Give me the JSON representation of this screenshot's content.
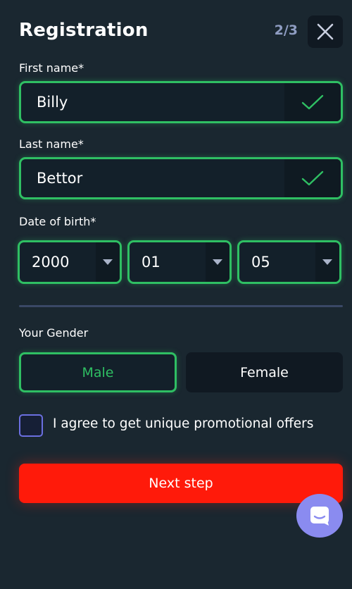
{
  "header": {
    "title": "Registration",
    "step": "2/3"
  },
  "form": {
    "first_name": {
      "label": "First name*",
      "value": "Billy"
    },
    "last_name": {
      "label": "Last name*",
      "value": "Bettor"
    },
    "dob": {
      "label": "Date of birth*",
      "year": "2000",
      "month": "01",
      "day": "05"
    },
    "gender": {
      "label": "Your Gender",
      "options": [
        "Male",
        "Female"
      ],
      "selected": "Male"
    },
    "promo": {
      "label": "I agree to get unique promotional offers",
      "checked": false
    },
    "submit_label": "Next step"
  },
  "colors": {
    "background": "#1a2730",
    "accent_green": "#2fbf63",
    "button_red": "#ff1a0a",
    "checkbox_border": "#6b6fe0",
    "chat_button": "#8a8bf0"
  },
  "icons": {
    "close": "close-icon",
    "check": "check-icon",
    "dropdown": "chevron-down-icon",
    "chat": "chat-icon"
  }
}
